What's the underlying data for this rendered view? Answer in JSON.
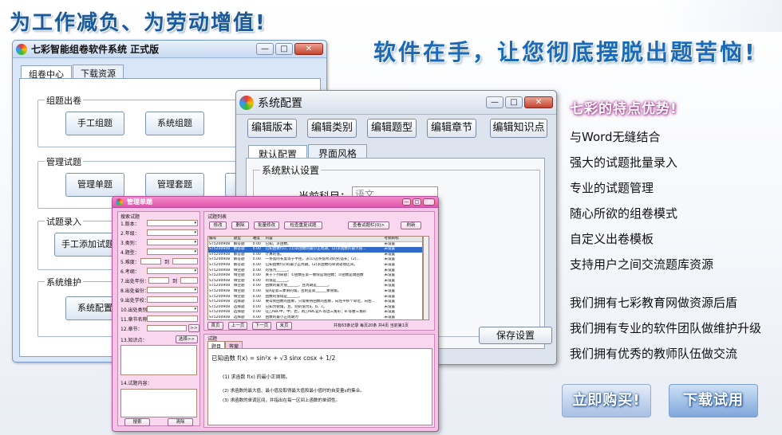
{
  "slogans": {
    "top": "为工作减负、为劳动增值!",
    "main": "软件在手，让您彻底摆脱出题苦恼!"
  },
  "main_window": {
    "title": "七彩智能组卷软件系统  正式版",
    "tabs": [
      "组卷中心",
      "下载资源"
    ],
    "groups": [
      {
        "label": "组题出卷",
        "buttons": [
          "手工组题",
          "系统组题"
        ]
      },
      {
        "label": "管理试题",
        "buttons": [
          "管理单题",
          "管理套题",
          "导"
        ]
      },
      {
        "label": "试题录入",
        "buttons": [
          "手工添加试题"
        ]
      },
      {
        "label": "系统维护",
        "buttons": [
          "系统配置"
        ]
      }
    ]
  },
  "config_window": {
    "title": "系统配置",
    "buttons": [
      "编辑版本",
      "编辑类别",
      "编辑题型",
      "编辑章节",
      "编辑知识点"
    ],
    "tabs": [
      "默认配置",
      "界面风格"
    ],
    "group_label": "系统默认设置",
    "subject_label": "当前科目：",
    "subject_value": "语文",
    "save": "保存设置"
  },
  "manage_window": {
    "title": "管理单题",
    "search_title": "搜索试题",
    "fields": [
      "1.版本：",
      "2.年级：",
      "3.类别：",
      "4.题型：",
      "5.难度：",
      "6.考纲：",
      "7.出处年份：",
      "8.出处省份：",
      "9.出处学校：",
      "10.出处类别：",
      "11.章节名称：",
      "12.章节："
    ],
    "to": "到",
    "chapter_btn": ">>",
    "knowledge_label": "13.知识点：",
    "select_btn": "选择>>",
    "content_label": "14.试题内容：",
    "search_btn": "搜索",
    "clear_btn": "清除",
    "list_title": "试题列表",
    "list_buttons": [
      "修改",
      "删除",
      "批量修改",
      "检查重复试题",
      "查看试题栏(0)>",
      "刷新"
    ],
    "columns": [
      "编号",
      "题型",
      "难度",
      "内容",
      "考纲目标"
    ],
    "rows": [
      [
        "ST5200908",
        "解答题",
        "0.00",
        "已知，求函数。",
        "未设置"
      ],
      [
        "ST5200908",
        "解答题",
        "0.00",
        "已知函数f(x)...(1)求函数的最小正周期。(2)求函数的最大值...",
        "未设置"
      ],
      [
        "ST5200908",
        "解答题",
        "0.00",
        "计算的值。",
        "未设置"
      ],
      [
        "ST5200908",
        "解答题",
        "0.00",
        "一条弦的长度等于半径，求(1)这条弦所对的劣弧长；(2)...",
        "未设置"
      ],
      [
        "ST5200908",
        "解答题",
        "0.00",
        "已知函数f(x)的最小正周期。(2)求函数的单调递增区间。",
        "未设置"
      ],
      [
        "ST5200908",
        "填空题",
        "0.00",
        "的值为______。",
        "未设置"
      ],
      [
        "ST5200908",
        "填空题",
        "0.00",
        "关于下列命题：①函数在第一象限是增函数；②函数是偶函数",
        "未设置"
      ],
      [
        "ST5200908",
        "填空题",
        "0.00",
        "的值是______。",
        "未设置"
      ],
      [
        "ST5200908",
        "填空题",
        "0.00",
        "函数的最大值______，且周期是______。",
        "未设置"
      ],
      [
        "ST5200908",
        "填空题",
        "0.00",
        "设A是第三象限的角，且则是第______象限角。",
        "未设置"
      ],
      [
        "ST5200908",
        "填空题",
        "0.00",
        "函数的值域是______。",
        "未设置"
      ],
      [
        "ST5200908",
        "选择题",
        "0.00",
        "要得到函数的图象，只需要将函数的图象，向左平移个单位，向右...",
        "未设置"
      ],
      [
        "ST5200908",
        "选择题",
        "0.00",
        "已知为锐角，且，则的值为a、b、c。",
        "未设置"
      ],
      [
        "ST5200908",
        "选择题",
        "0.00",
        "在△ABC中，中，若，则△ABC是A.等边三角形；B.等腰三角形",
        "未设置"
      ],
      [
        "ST5200908",
        "选择题",
        "0.00",
        "函数的最小正周期为",
        "未设置"
      ]
    ],
    "pager": [
      "首页",
      "上一页",
      "下一页",
      "末页"
    ],
    "pager_info": "共有63条记录 每页20条 共4页 当前第1页",
    "detail_title": "试题",
    "detail_tabs": [
      "题目",
      "答案"
    ],
    "question": "已知函数 f(x) = sin²x + √3 sinx cosx + 1/2",
    "q_lines": [
      "(1) 求函数 f(x) 的最小正周期。",
      "(2) 求函数的最大值、最小值及取得最大值和最小值时的自变量x的集合。",
      "(3) 求函数的单调区间，并指出在每一区间上函数的单调性。"
    ]
  },
  "features": {
    "title": "七彩的特点优势!",
    "items": [
      "与Word无缝结合",
      "强大的试题批量录入",
      "专业的试题管理",
      "随心所欲的组卷模式",
      "自定义出卷模板",
      "支持用户之间交流题库资源"
    ],
    "claims": [
      "我们拥有七彩教育网做资源后盾",
      "我们拥有专业的软件团队做维护升级",
      "我们拥有优秀的教师队伍做交流"
    ]
  },
  "cta": {
    "buy": "立即购买!",
    "download": "下载试用"
  },
  "colors": {
    "accent": "#1a6ab8",
    "pink_window": "#f5c3e8",
    "selected_row": "#2f6acb"
  }
}
